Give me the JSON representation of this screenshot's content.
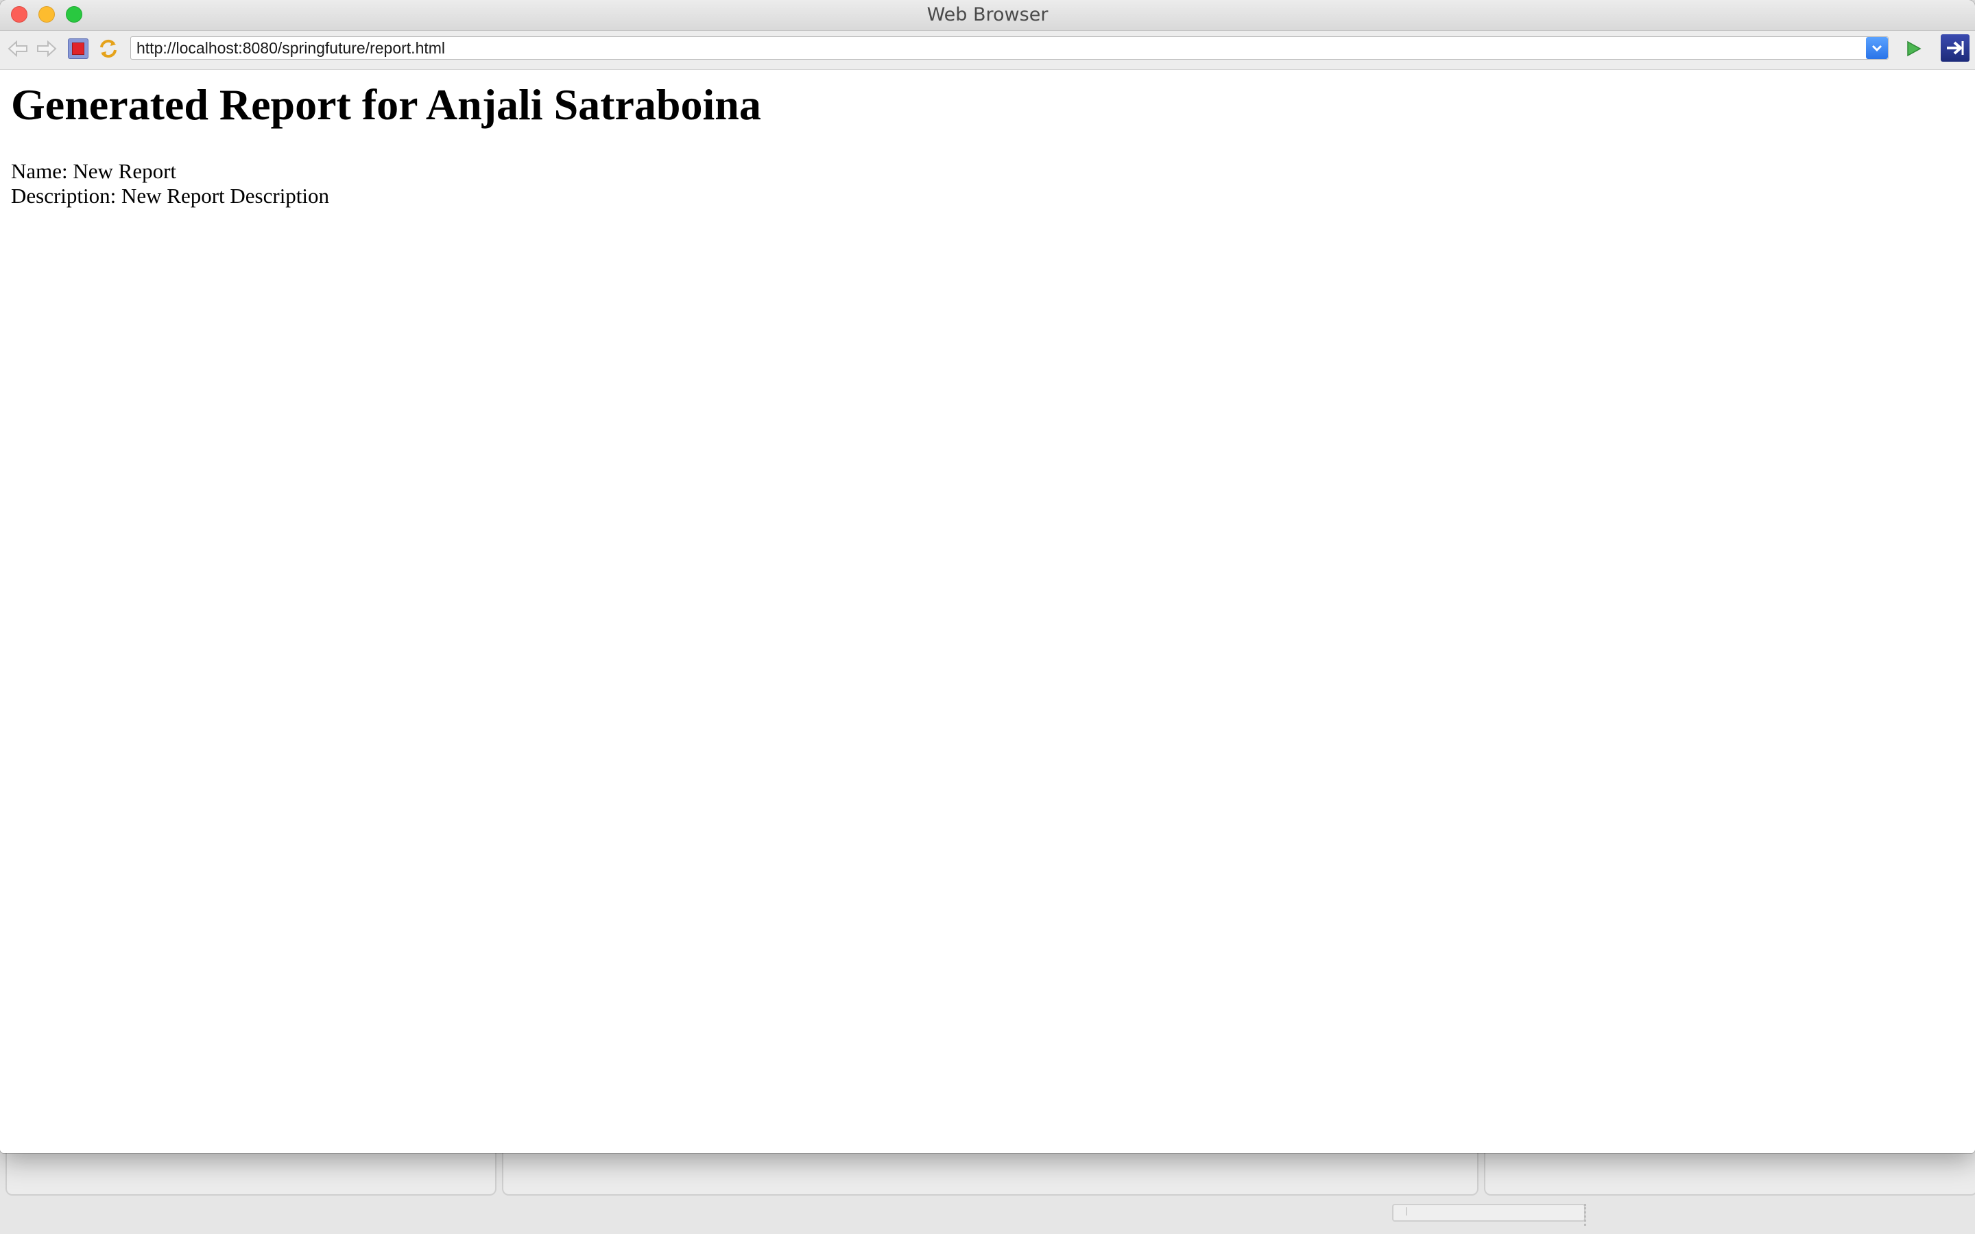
{
  "window": {
    "title": "Web Browser"
  },
  "toolbar": {
    "back_icon": "back-arrow-icon",
    "forward_icon": "forward-arrow-icon",
    "stop_icon": "stop-icon",
    "refresh_icon": "refresh-icon",
    "go_icon": "play-icon",
    "navigate_icon": "navigate-icon"
  },
  "address_bar": {
    "url": "http://localhost:8080/springfuture/report.html"
  },
  "page": {
    "heading": "Generated Report for Anjali Satraboina",
    "name_line": "Name: New Report",
    "description_line": "Description: New Report Description"
  },
  "colors": {
    "close": "#fc5f57",
    "minimize": "#fdbc2f",
    "maximize": "#29c840",
    "go": "#3aa043",
    "navigate": "#2a3a9a"
  }
}
